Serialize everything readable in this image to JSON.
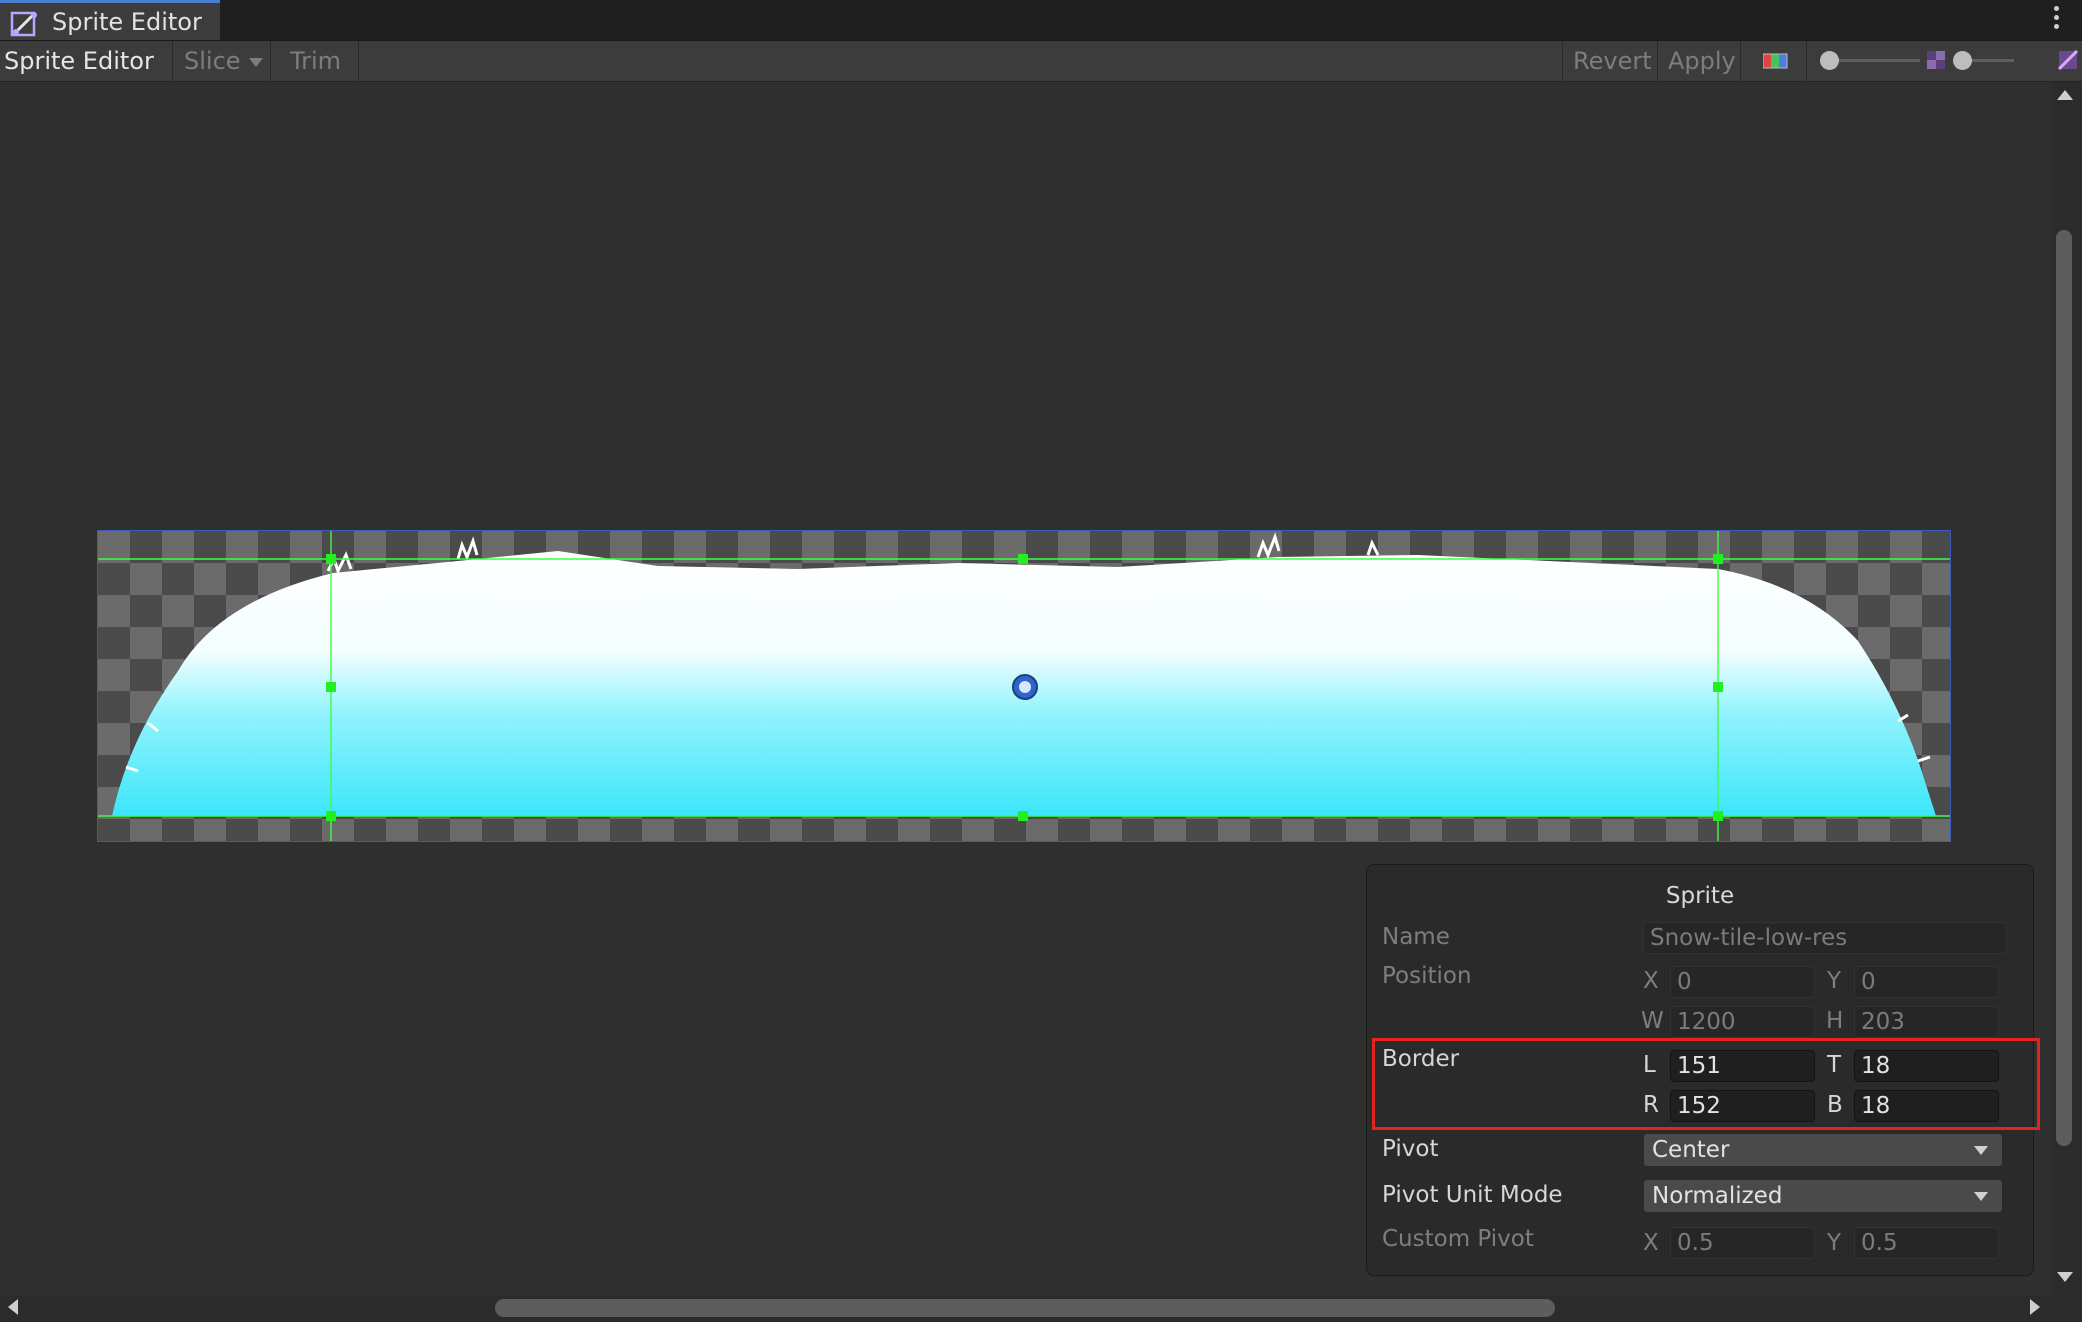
{
  "window": {
    "tab_title": "Sprite Editor"
  },
  "toolbar": {
    "mode_label": "Sprite Editor",
    "slice_label": "Slice",
    "trim_label": "Trim",
    "revert_label": "Revert",
    "apply_label": "Apply"
  },
  "sprite_panel": {
    "title": "Sprite",
    "name_label": "Name",
    "name_value": "Snow-tile-low-res",
    "position_label": "Position",
    "pos_x_label": "X",
    "pos_x": "0",
    "pos_y_label": "Y",
    "pos_y": "0",
    "pos_w_label": "W",
    "pos_w": "1200",
    "pos_h_label": "H",
    "pos_h": "203",
    "border_label": "Border",
    "border_l_label": "L",
    "border_l": "151",
    "border_t_label": "T",
    "border_t": "18",
    "border_r_label": "R",
    "border_r": "152",
    "border_b_label": "B",
    "border_b": "18",
    "pivot_label": "Pivot",
    "pivot_value": "Center",
    "pivot_unit_label": "Pivot Unit Mode",
    "pivot_unit_value": "Normalized",
    "custom_pivot_label": "Custom Pivot",
    "cp_x_label": "X",
    "cp_x": "0.5",
    "cp_y_label": "Y",
    "cp_y": "0.5"
  },
  "colors": {
    "accent": "#4a7fd0",
    "highlight_box": "#e3261d",
    "border_guides": "#3cff3c",
    "snow_top": "#ffffff",
    "snow_bottom": "#3ee6fa"
  },
  "icons": {
    "tab": "sprite-editor-icon",
    "menu": "kebab-menu-icon",
    "color_channels": "rgb-channels-icon",
    "zoom": "zoom-slider",
    "mip": "mipmap-icon",
    "alpha": "alpha-checker-icon",
    "pivot": "pivot-handle-icon"
  }
}
